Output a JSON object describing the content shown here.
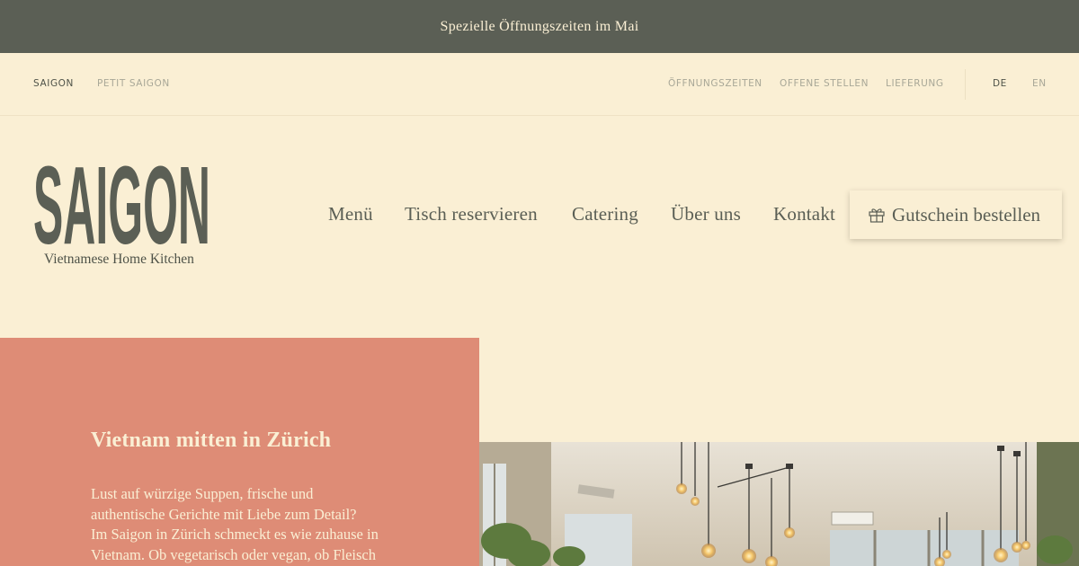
{
  "announcement": "Spezielle Öffnungszeiten im Mai",
  "topnav": {
    "left": [
      "SAIGON",
      "PETIT SAIGON"
    ],
    "right": [
      "ÖFFNUNGSZEITEN",
      "OFFENE STELLEN",
      "LIEFERUNG"
    ],
    "languages": [
      "DE",
      "EN"
    ],
    "active_restaurant": "SAIGON",
    "active_language": "DE"
  },
  "logo": {
    "wordmark": "SAIGON",
    "tagline": "Vietnamese Home Kitchen"
  },
  "mainnav": {
    "items": [
      "Menü",
      "Tisch reservieren",
      "Catering",
      "Über uns",
      "Kontakt"
    ],
    "voucher_label": "Gutschein bestellen",
    "voucher_icon": "gift-icon"
  },
  "hero": {
    "title": "Vietnam mitten in Zürich",
    "body_lines": [
      "Lust auf würzige Suppen, frische und",
      "authentische Gerichte mit Liebe zum Detail?",
      "Im Saigon in Zürich schmeckt es wie zuhause in",
      "Vietnam. Ob vegetarisch oder vegan, ob Fleisch"
    ]
  },
  "colors": {
    "olive": "#5b5f55",
    "cream": "#faefd4",
    "terracotta": "#de8c76"
  }
}
